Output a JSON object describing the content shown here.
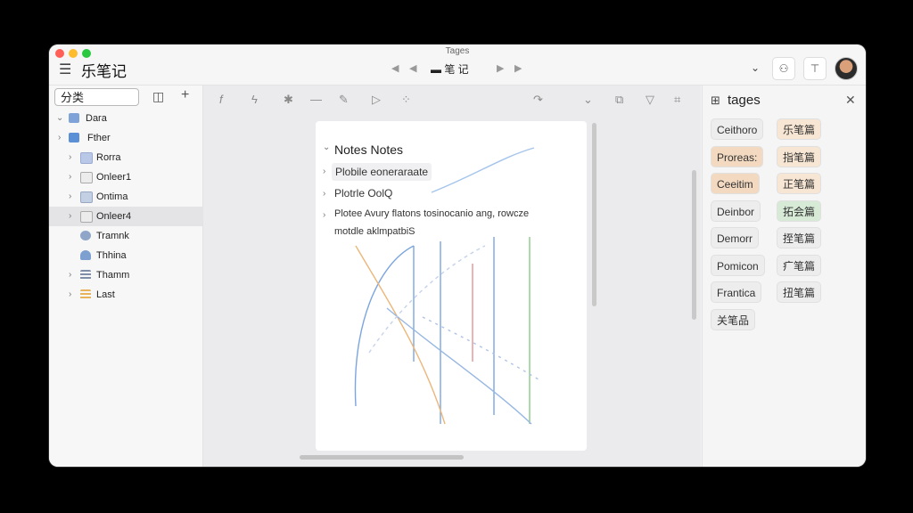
{
  "window": {
    "title": "Tages",
    "app_name": "乐笔记",
    "doc_title": "▬ 笔 记"
  },
  "sidebar": {
    "category_label": "分类",
    "items": [
      {
        "label": "Dara",
        "expanded": true,
        "color": "#7fa3d8"
      },
      {
        "label": "Fther",
        "expanded": false,
        "color": "#5b8fd6"
      },
      {
        "label": "Rorra",
        "expanded": false,
        "color": "#b8c8e6"
      },
      {
        "label": "Onleer1",
        "expanded": false,
        "color": "#d4d4d4"
      },
      {
        "label": "Ontima",
        "expanded": false,
        "color": "#c3cfe2"
      },
      {
        "label": "Onleer4",
        "expanded": false,
        "color": "#d4d4d4"
      },
      {
        "label": "Tramnk",
        "expanded": false,
        "color": "#8fa6c8"
      },
      {
        "label": "Thhina",
        "expanded": false,
        "color": "#7ea0d0"
      },
      {
        "label": "Thamm",
        "expanded": false,
        "color": "#7e8ea8"
      },
      {
        "label": "Last",
        "expanded": false,
        "color": "#e6b25a"
      }
    ]
  },
  "toolbar": {
    "icons": [
      "function-icon",
      "flash-icon",
      "asterisk-icon",
      "minus-icon",
      "pen-icon",
      "play-icon",
      "grid-icon",
      "redo-icon",
      "chevron-down-icon",
      "layers-icon",
      "comment-icon",
      "code-icon"
    ]
  },
  "note": {
    "heading": "Notes Notes",
    "lines": [
      "Plobile eoneraraate",
      "Plotrle OolQ",
      "Plotee Avury flatons tosinocanio ang, rowcze",
      "motdle aklmpatbiS"
    ]
  },
  "tags": {
    "title": "tages",
    "items": [
      {
        "label": "Ceithoro",
        "color": "#ededee"
      },
      {
        "label": "乐笔篇",
        "color": "#f7e6d3"
      },
      {
        "label": "Proreas:",
        "color": "#f3d9c0"
      },
      {
        "label": "指笔篇",
        "color": "#f7e6d3"
      },
      {
        "label": "Ceeitim",
        "color": "#f3d9c0"
      },
      {
        "label": "正笔篇",
        "color": "#f7e6d3"
      },
      {
        "label": "Deinbor",
        "color": "#ededee"
      },
      {
        "label": "拓会篇",
        "color": "#d6ead6"
      },
      {
        "label": "Demorr",
        "color": "#ededee"
      },
      {
        "label": "挃笔篇",
        "color": "#ededee"
      },
      {
        "label": "Pomicon",
        "color": "#ededee"
      },
      {
        "label": "疒笔篇",
        "color": "#ededee"
      },
      {
        "label": "Frantica",
        "color": "#ededee"
      },
      {
        "label": "扭笔篇",
        "color": "#ededee"
      },
      {
        "label": "关笔品",
        "color": "#ededee"
      }
    ]
  }
}
